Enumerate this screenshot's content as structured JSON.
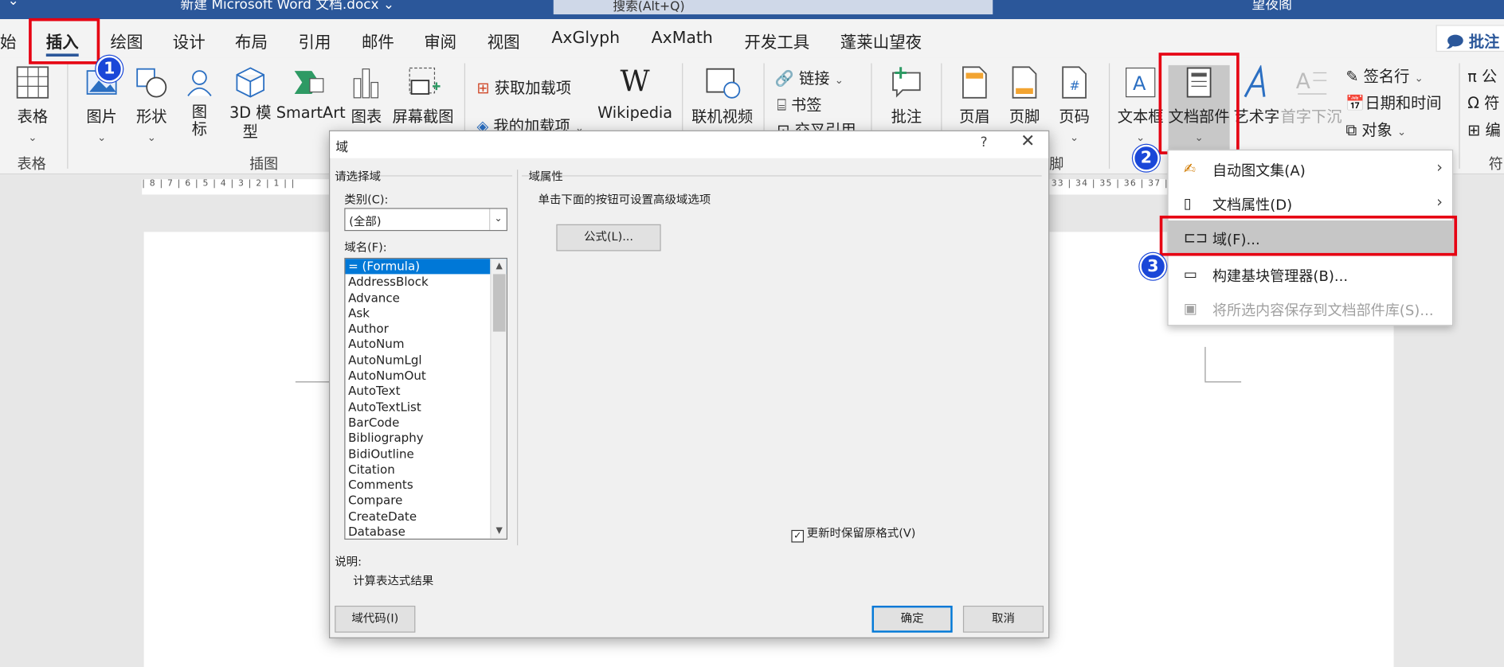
{
  "titlebar": {
    "doc_title": "新建 Microsoft Word 文档.docx ⌄",
    "search_placeholder": "搜索(Alt+Q)",
    "user": "望夜阁"
  },
  "tabs": [
    {
      "label": "始"
    },
    {
      "label": "插入",
      "active": true
    },
    {
      "label": "绘图"
    },
    {
      "label": "设计"
    },
    {
      "label": "布局"
    },
    {
      "label": "引用"
    },
    {
      "label": "邮件"
    },
    {
      "label": "审阅"
    },
    {
      "label": "视图"
    },
    {
      "label": "AxGlyph"
    },
    {
      "label": "AxMath"
    },
    {
      "label": "开发工具"
    },
    {
      "label": "蓬莱山望夜"
    }
  ],
  "comment_button": "批注",
  "ribbon": {
    "table": "表格",
    "picture": "图片",
    "shapes": "形状",
    "icons": "图\n标",
    "model3d": "3D 模\n型",
    "smartart": "SmartArt",
    "chart": "图表",
    "screenshot": "屏幕截图",
    "get_addins": "获取加载项",
    "my_addins": "我的加载项",
    "wikipedia": "Wikipedia",
    "online_video": "联机视频",
    "link": "链接",
    "bookmark": "书签",
    "cross_ref": "交叉引用",
    "comment": "批注",
    "header": "页眉",
    "footer": "页脚",
    "page_number": "页码",
    "textbox": "文本框",
    "quick_parts": "文档部件",
    "wordart": "艺术字",
    "dropcap": "首字下沉",
    "signature": "签名行",
    "datetime": "日期和时间",
    "object": "对象",
    "equation": "π 公",
    "symbol": "Ω 符",
    "number": "编",
    "group_table": "表格",
    "group_illus": "插图",
    "group_hf": "脚",
    "group_sym": "符"
  },
  "badges": {
    "one": "1",
    "two": "2",
    "three": "3"
  },
  "ruler_left": "| 8 | 7 | 6 | 5 | 4 | 3 | 2 | 1 | |",
  "ruler_right": "33 | 34 | 35 | 36 | 37 |",
  "dialog": {
    "title": "域",
    "help": "?",
    "close": "✕",
    "choose_field": "请选择域",
    "category_label": "类别(C):",
    "category_value": "(全部)",
    "field_names_label": "域名(F):",
    "fields": [
      "= (Formula)",
      "AddressBlock",
      "Advance",
      "Ask",
      "Author",
      "AutoNum",
      "AutoNumLgl",
      "AutoNumOut",
      "AutoText",
      "AutoTextList",
      "BarCode",
      "Bibliography",
      "BidiOutline",
      "Citation",
      "Comments",
      "Compare",
      "CreateDate",
      "Database"
    ],
    "field_props": "域属性",
    "hint": "单击下面的按钮可设置高级域选项",
    "formula_button": "公式(L)...",
    "preserve_format": "更新时保留原格式(V)",
    "description_label": "说明:",
    "description": "计算表达式结果",
    "field_codes_button": "域代码(I)",
    "ok_button": "确定",
    "cancel_button": "取消"
  },
  "menu": {
    "items": [
      {
        "label": "自动图文集(A)",
        "submenu": true
      },
      {
        "label": "文档属性(D)",
        "submenu": true
      },
      {
        "label": "域(F)...",
        "highlighted": true
      },
      {
        "label": "构建基块管理器(B)..."
      },
      {
        "label": "将所选内容保存到文档部件库(S)...",
        "disabled": true
      }
    ]
  }
}
